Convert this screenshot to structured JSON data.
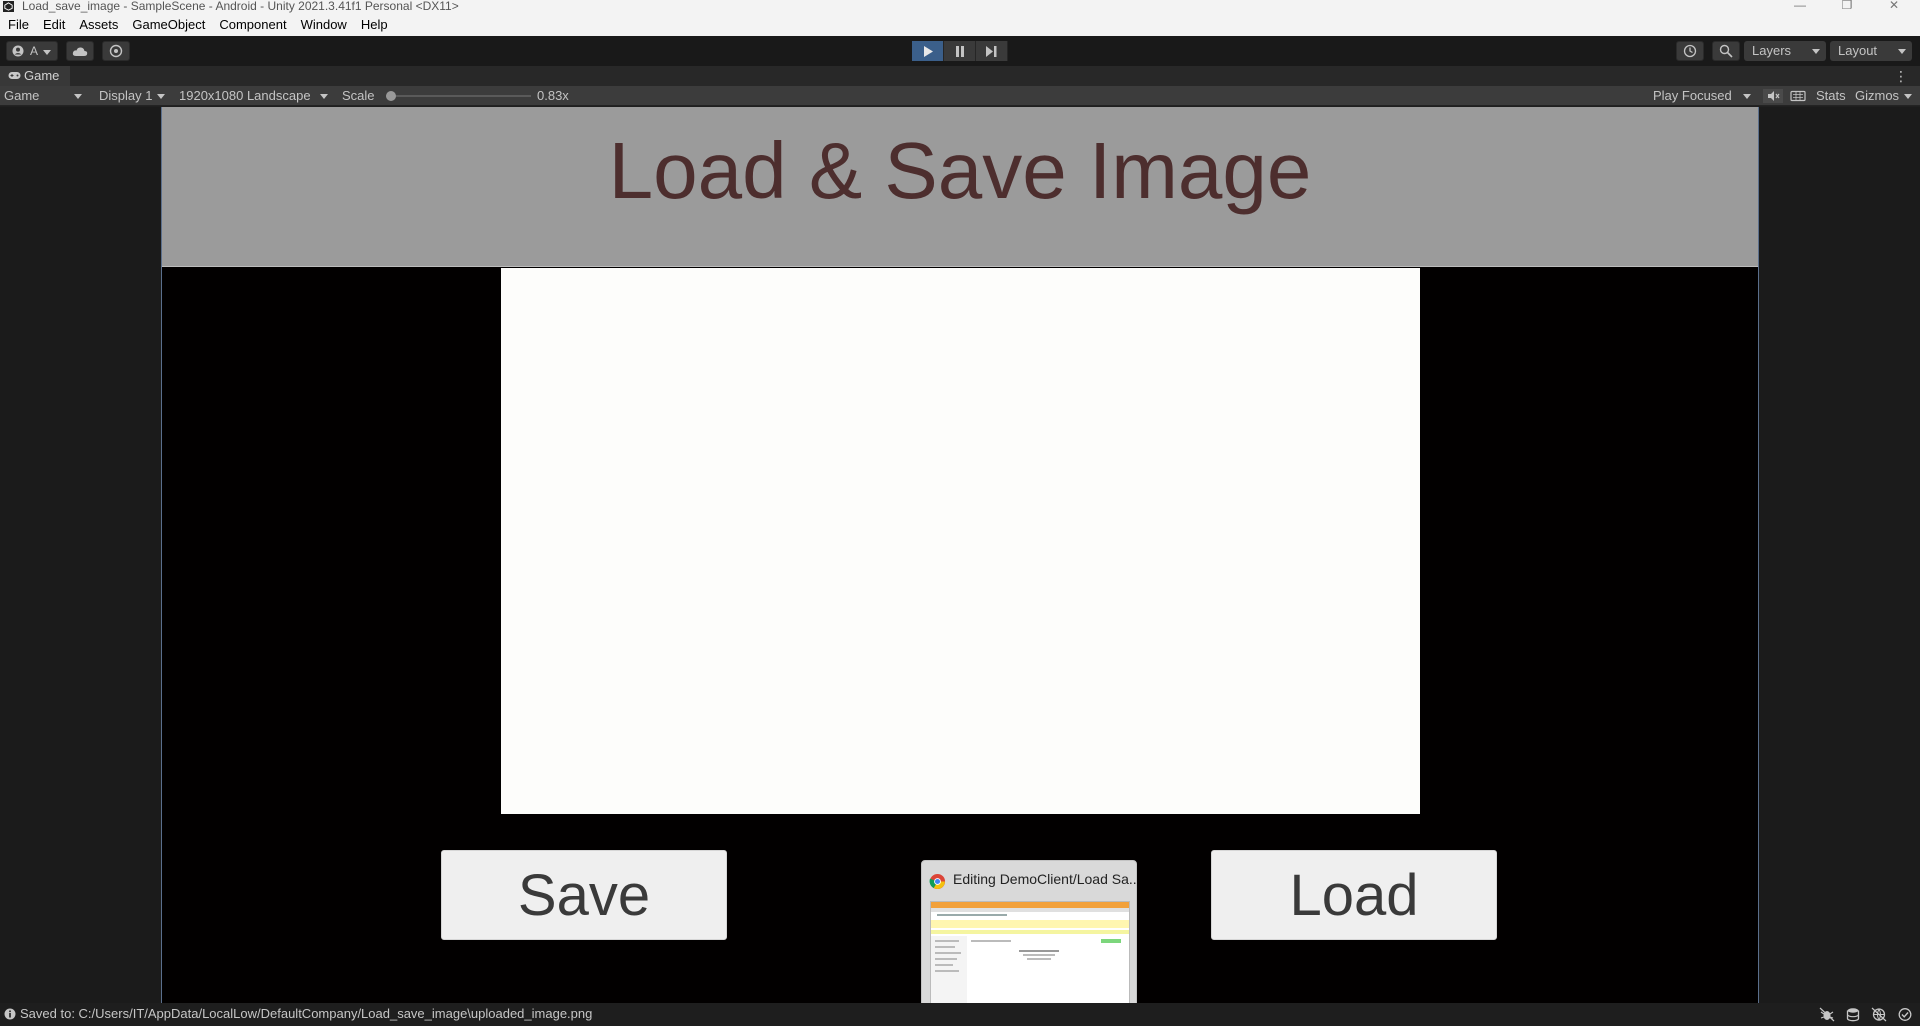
{
  "window": {
    "title": "Load_save_image - SampleScene - Android - Unity 2021.3.41f1 Personal <DX11>"
  },
  "menu": [
    "File",
    "Edit",
    "Assets",
    "GameObject",
    "Component",
    "Window",
    "Help"
  ],
  "toolbar": {
    "account_label": "A",
    "layers_label": "Layers",
    "layout_label": "Layout",
    "play_active": true
  },
  "tab": {
    "label": "Game"
  },
  "gamebar": {
    "view_dropdown": "Game",
    "display_dropdown": "Display 1",
    "resolution_dropdown": "1920x1080 Landscape",
    "scale_label": "Scale",
    "scale_value": "0.83x",
    "scale_fraction": 0.0,
    "play_focused_dropdown": "Play Focused",
    "stats_label": "Stats",
    "gizmos_label": "Gizmos"
  },
  "game": {
    "header_title": "Load & Save Image",
    "save_button": "Save",
    "load_button": "Load"
  },
  "preview": {
    "title": "Editing DemoClient/Load Sa..."
  },
  "status": {
    "message": "Saved to: C:/Users/IT/AppData/LocalLow/DefaultCompany/Load_save_image\\uploaded_image.png"
  },
  "colors": {
    "accent_play": "#3b5f8a",
    "header_band": "#9b9b9b",
    "header_text": "#4d2e2e"
  }
}
